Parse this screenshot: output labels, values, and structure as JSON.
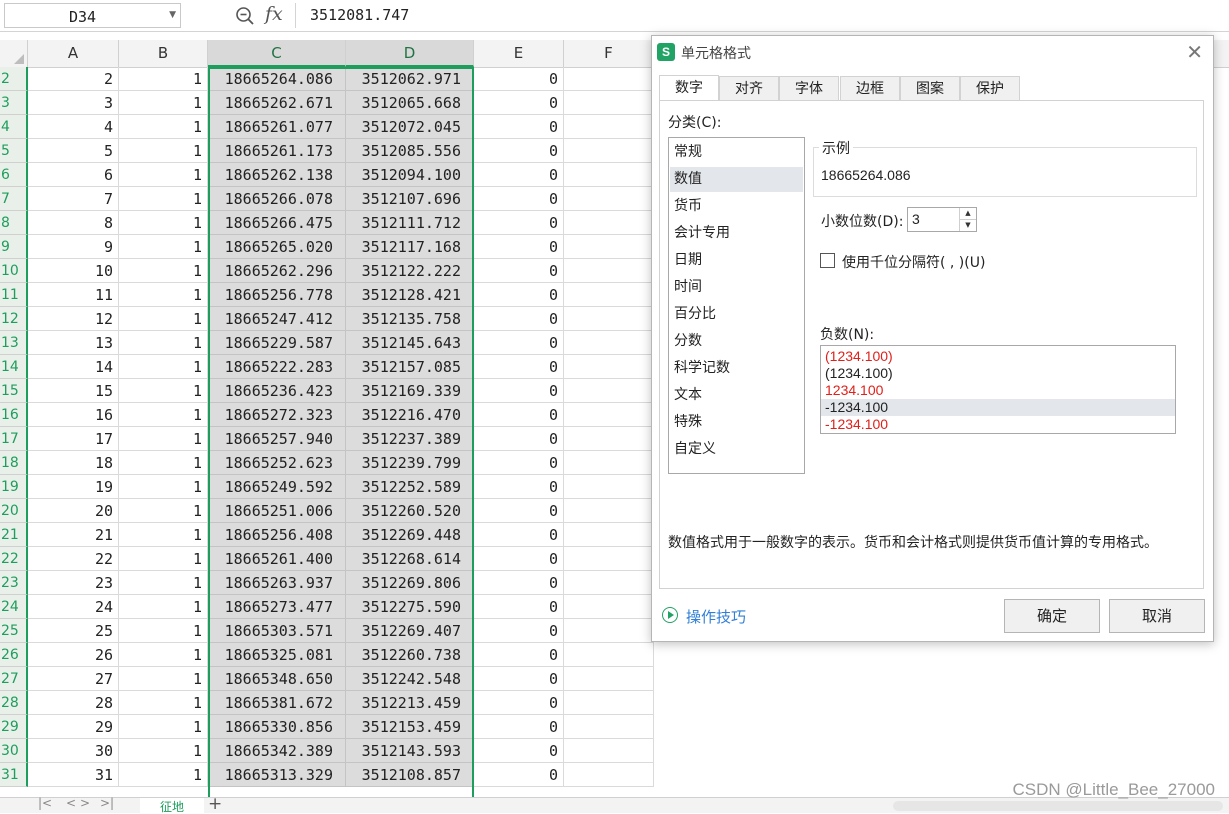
{
  "formula_bar": {
    "cell_ref": "D34",
    "formula": "3512081.747"
  },
  "columns": [
    "A",
    "B",
    "C",
    "D",
    "E",
    "F"
  ],
  "rows": [
    {
      "num": "2",
      "a": "2",
      "b": "1",
      "c": "18665264.086",
      "d": "3512062.971",
      "e": "0"
    },
    {
      "num": "3",
      "a": "3",
      "b": "1",
      "c": "18665262.671",
      "d": "3512065.668",
      "e": "0"
    },
    {
      "num": "4",
      "a": "4",
      "b": "1",
      "c": "18665261.077",
      "d": "3512072.045",
      "e": "0"
    },
    {
      "num": "5",
      "a": "5",
      "b": "1",
      "c": "18665261.173",
      "d": "3512085.556",
      "e": "0"
    },
    {
      "num": "6",
      "a": "6",
      "b": "1",
      "c": "18665262.138",
      "d": "3512094.100",
      "e": "0"
    },
    {
      "num": "7",
      "a": "7",
      "b": "1",
      "c": "18665266.078",
      "d": "3512107.696",
      "e": "0"
    },
    {
      "num": "8",
      "a": "8",
      "b": "1",
      "c": "18665266.475",
      "d": "3512111.712",
      "e": "0"
    },
    {
      "num": "9",
      "a": "9",
      "b": "1",
      "c": "18665265.020",
      "d": "3512117.168",
      "e": "0"
    },
    {
      "num": "10",
      "a": "10",
      "b": "1",
      "c": "18665262.296",
      "d": "3512122.222",
      "e": "0"
    },
    {
      "num": "11",
      "a": "11",
      "b": "1",
      "c": "18665256.778",
      "d": "3512128.421",
      "e": "0"
    },
    {
      "num": "12",
      "a": "12",
      "b": "1",
      "c": "18665247.412",
      "d": "3512135.758",
      "e": "0"
    },
    {
      "num": "13",
      "a": "13",
      "b": "1",
      "c": "18665229.587",
      "d": "3512145.643",
      "e": "0"
    },
    {
      "num": "14",
      "a": "14",
      "b": "1",
      "c": "18665222.283",
      "d": "3512157.085",
      "e": "0"
    },
    {
      "num": "15",
      "a": "15",
      "b": "1",
      "c": "18665236.423",
      "d": "3512169.339",
      "e": "0"
    },
    {
      "num": "16",
      "a": "16",
      "b": "1",
      "c": "18665272.323",
      "d": "3512216.470",
      "e": "0"
    },
    {
      "num": "17",
      "a": "17",
      "b": "1",
      "c": "18665257.940",
      "d": "3512237.389",
      "e": "0"
    },
    {
      "num": "18",
      "a": "18",
      "b": "1",
      "c": "18665252.623",
      "d": "3512239.799",
      "e": "0"
    },
    {
      "num": "19",
      "a": "19",
      "b": "1",
      "c": "18665249.592",
      "d": "3512252.589",
      "e": "0"
    },
    {
      "num": "20",
      "a": "20",
      "b": "1",
      "c": "18665251.006",
      "d": "3512260.520",
      "e": "0"
    },
    {
      "num": "21",
      "a": "21",
      "b": "1",
      "c": "18665256.408",
      "d": "3512269.448",
      "e": "0"
    },
    {
      "num": "22",
      "a": "22",
      "b": "1",
      "c": "18665261.400",
      "d": "3512268.614",
      "e": "0"
    },
    {
      "num": "23",
      "a": "23",
      "b": "1",
      "c": "18665263.937",
      "d": "3512269.806",
      "e": "0"
    },
    {
      "num": "24",
      "a": "24",
      "b": "1",
      "c": "18665273.477",
      "d": "3512275.590",
      "e": "0"
    },
    {
      "num": "25",
      "a": "25",
      "b": "1",
      "c": "18665303.571",
      "d": "3512269.407",
      "e": "0"
    },
    {
      "num": "26",
      "a": "26",
      "b": "1",
      "c": "18665325.081",
      "d": "3512260.738",
      "e": "0"
    },
    {
      "num": "27",
      "a": "27",
      "b": "1",
      "c": "18665348.650",
      "d": "3512242.548",
      "e": "0"
    },
    {
      "num": "28",
      "a": "28",
      "b": "1",
      "c": "18665381.672",
      "d": "3512213.459",
      "e": "0"
    },
    {
      "num": "29",
      "a": "29",
      "b": "1",
      "c": "18665330.856",
      "d": "3512153.459",
      "e": "0"
    },
    {
      "num": "30",
      "a": "30",
      "b": "1",
      "c": "18665342.389",
      "d": "3512143.593",
      "e": "0"
    },
    {
      "num": "31",
      "a": "31",
      "b": "1",
      "c": "18665313.329",
      "d": "3512108.857",
      "e": "0"
    }
  ],
  "sheet_tab": "征地",
  "dialog": {
    "title": "单元格格式",
    "tabs": [
      "数字",
      "对齐",
      "字体",
      "边框",
      "图案",
      "保护"
    ],
    "active_tab": "数字",
    "category_label": "分类(C):",
    "categories": [
      "常规",
      "数值",
      "货币",
      "会计专用",
      "日期",
      "时间",
      "百分比",
      "分数",
      "科学记数",
      "文本",
      "特殊",
      "自定义"
    ],
    "selected_category": "数值",
    "sample_label": "示例",
    "sample_value": "18665264.086",
    "decimals_label": "小数位数(D):",
    "decimals_value": "3",
    "thousands_label": "使用千位分隔符( , )(U)",
    "negative_label": "负数(N):",
    "negative_options": [
      {
        "text": "(1234.100)",
        "color": "#e0201b"
      },
      {
        "text": "(1234.100)",
        "color": "#222222"
      },
      {
        "text": "1234.100",
        "color": "#e0201b"
      },
      {
        "text": "-1234.100",
        "color": "#222222"
      },
      {
        "text": "-1234.100",
        "color": "#e0201b"
      }
    ],
    "selected_negative_index": 3,
    "description": "数值格式用于一般数字的表示。货币和会计格式则提供货币值计算的专用格式。",
    "tips_label": "操作技巧",
    "ok_label": "确定",
    "cancel_label": "取消"
  },
  "watermark": "CSDN @Little_Bee_27000",
  "colors": {
    "accent_green": "#1e9e5c",
    "selected_column_bg": "#dcdcdc",
    "link_blue": "#2f7fd8"
  }
}
